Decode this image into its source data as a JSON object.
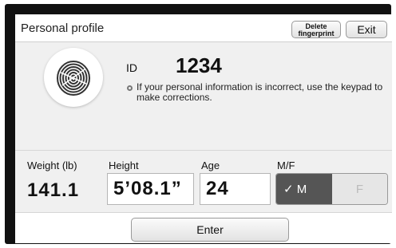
{
  "header": {
    "title": "Personal profile",
    "delete_button": "Delete fingerprint",
    "exit_button": "Exit"
  },
  "profile": {
    "id_label": "ID",
    "id_value": "1234",
    "info_text": "If your personal information is incorrect, use the keypad to make corrections."
  },
  "fields": {
    "weight_label": "Weight (lb)",
    "weight_value": "141.1",
    "height_label": "Height",
    "height_value": "5’08.1”",
    "age_label": "Age",
    "age_value": "24",
    "sex_label": "M/F",
    "male_option": "✓ M",
    "female_option": "F",
    "selected": "M"
  },
  "footer": {
    "enter_button": "Enter"
  },
  "colors": {
    "selected_toggle": "#555555",
    "unselected_toggle": "#e6e6e6"
  }
}
